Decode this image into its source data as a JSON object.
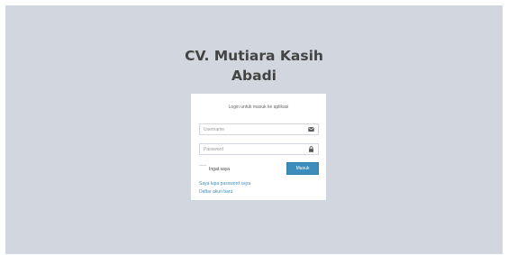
{
  "brand": {
    "line1": "CV. Mutiara Kasih",
    "line2": "Abadi"
  },
  "login": {
    "message": "Login untuk masuk ke aplikasi",
    "username_placeholder": "Username",
    "username_value": "",
    "password_placeholder": "Password",
    "password_value": "",
    "remember_label": "Ingat saya",
    "remember_checked": false,
    "submit_label": "Masuk",
    "forgot_link": "Saya lupa password saya",
    "register_link": "Daftar akun baru"
  },
  "icons": {
    "username": "envelope-icon",
    "password": "lock-icon"
  },
  "colors": {
    "background": "#d2d6de",
    "primary": "#3c8dbc",
    "box": "#ffffff",
    "brand_text": "#444444"
  }
}
